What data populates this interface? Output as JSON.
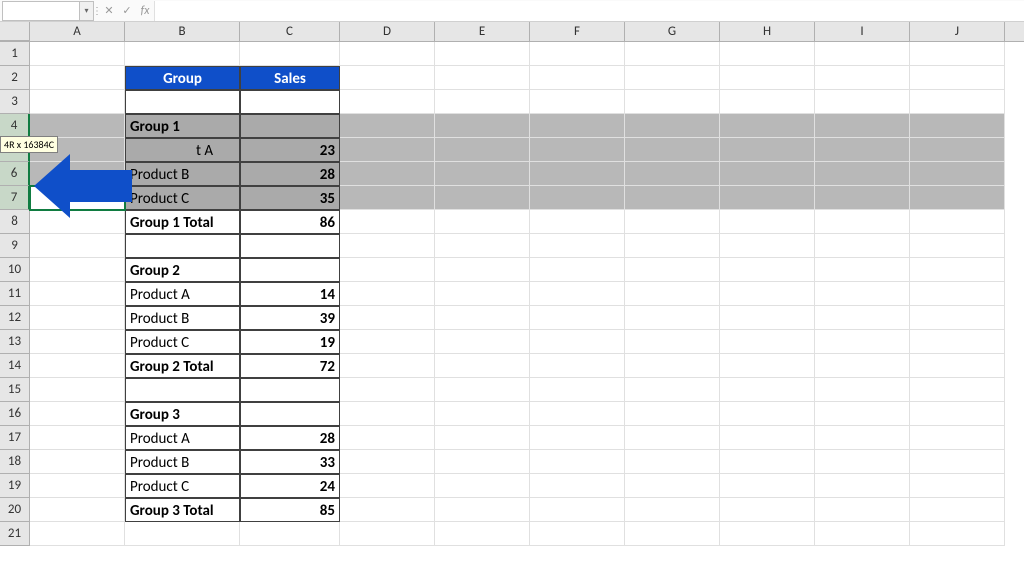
{
  "formula_bar": {
    "name_box": "",
    "formula": ""
  },
  "tooltip": "4R x 16384C",
  "columns": [
    "A",
    "B",
    "C",
    "D",
    "E",
    "F",
    "G",
    "H",
    "I",
    "J"
  ],
  "rows": [
    "1",
    "2",
    "3",
    "4",
    "5",
    "6",
    "7",
    "8",
    "9",
    "10",
    "11",
    "12",
    "13",
    "14",
    "15",
    "16",
    "17",
    "18",
    "19",
    "20",
    "21"
  ],
  "headers": {
    "group": "Group",
    "sales": "Sales"
  },
  "table": {
    "g1": {
      "title": "Group 1",
      "rows": [
        [
          "Product A",
          "23"
        ],
        [
          "Product B",
          "28"
        ],
        [
          "Product C",
          "35"
        ]
      ],
      "total_label": "Group 1 Total",
      "total": "86"
    },
    "g2": {
      "title": "Group 2",
      "rows": [
        [
          "Product A",
          "14"
        ],
        [
          "Product B",
          "39"
        ],
        [
          "Product C",
          "19"
        ]
      ],
      "total_label": "Group 2 Total",
      "total": "72"
    },
    "g3": {
      "title": "Group 3",
      "rows": [
        [
          "Product A",
          "28"
        ],
        [
          "Product B",
          "33"
        ],
        [
          "Product C",
          "24"
        ]
      ],
      "total_label": "Group 3 Total",
      "total": "85"
    }
  },
  "arrow_tipA": "t A"
}
